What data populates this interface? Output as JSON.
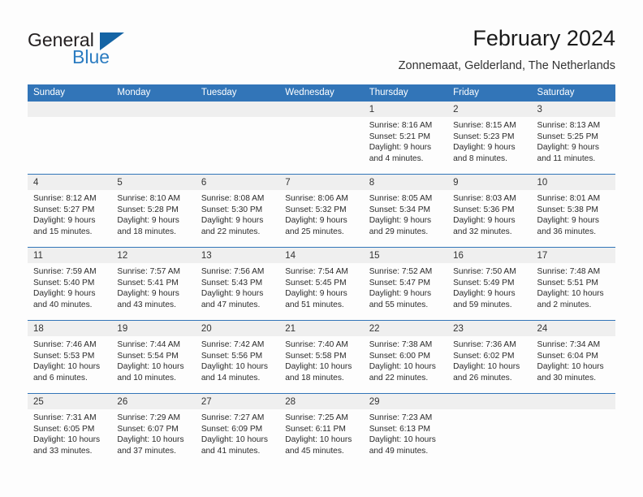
{
  "brand": {
    "name_part1": "General",
    "name_part2": "Blue",
    "triangle_icon": "blue-triangle-logo-icon",
    "accent_color": "#2b7cc1"
  },
  "header": {
    "title": "February 2024",
    "subtitle": "Zonnemaat, Gelderland, The Netherlands"
  },
  "colors": {
    "header_blue": "#3275b8",
    "daynum_band": "#efefef",
    "page_background": "#fdfdfd"
  },
  "calendar": {
    "weekday_headers": [
      "Sunday",
      "Monday",
      "Tuesday",
      "Wednesday",
      "Thursday",
      "Friday",
      "Saturday"
    ],
    "weeks": [
      [
        {
          "day": "",
          "lines": []
        },
        {
          "day": "",
          "lines": []
        },
        {
          "day": "",
          "lines": []
        },
        {
          "day": "",
          "lines": []
        },
        {
          "day": "1",
          "lines": [
            "Sunrise: 8:16 AM",
            "Sunset: 5:21 PM",
            "Daylight: 9 hours",
            "and 4 minutes."
          ]
        },
        {
          "day": "2",
          "lines": [
            "Sunrise: 8:15 AM",
            "Sunset: 5:23 PM",
            "Daylight: 9 hours",
            "and 8 minutes."
          ]
        },
        {
          "day": "3",
          "lines": [
            "Sunrise: 8:13 AM",
            "Sunset: 5:25 PM",
            "Daylight: 9 hours",
            "and 11 minutes."
          ]
        }
      ],
      [
        {
          "day": "4",
          "lines": [
            "Sunrise: 8:12 AM",
            "Sunset: 5:27 PM",
            "Daylight: 9 hours",
            "and 15 minutes."
          ]
        },
        {
          "day": "5",
          "lines": [
            "Sunrise: 8:10 AM",
            "Sunset: 5:28 PM",
            "Daylight: 9 hours",
            "and 18 minutes."
          ]
        },
        {
          "day": "6",
          "lines": [
            "Sunrise: 8:08 AM",
            "Sunset: 5:30 PM",
            "Daylight: 9 hours",
            "and 22 minutes."
          ]
        },
        {
          "day": "7",
          "lines": [
            "Sunrise: 8:06 AM",
            "Sunset: 5:32 PM",
            "Daylight: 9 hours",
            "and 25 minutes."
          ]
        },
        {
          "day": "8",
          "lines": [
            "Sunrise: 8:05 AM",
            "Sunset: 5:34 PM",
            "Daylight: 9 hours",
            "and 29 minutes."
          ]
        },
        {
          "day": "9",
          "lines": [
            "Sunrise: 8:03 AM",
            "Sunset: 5:36 PM",
            "Daylight: 9 hours",
            "and 32 minutes."
          ]
        },
        {
          "day": "10",
          "lines": [
            "Sunrise: 8:01 AM",
            "Sunset: 5:38 PM",
            "Daylight: 9 hours",
            "and 36 minutes."
          ]
        }
      ],
      [
        {
          "day": "11",
          "lines": [
            "Sunrise: 7:59 AM",
            "Sunset: 5:40 PM",
            "Daylight: 9 hours",
            "and 40 minutes."
          ]
        },
        {
          "day": "12",
          "lines": [
            "Sunrise: 7:57 AM",
            "Sunset: 5:41 PM",
            "Daylight: 9 hours",
            "and 43 minutes."
          ]
        },
        {
          "day": "13",
          "lines": [
            "Sunrise: 7:56 AM",
            "Sunset: 5:43 PM",
            "Daylight: 9 hours",
            "and 47 minutes."
          ]
        },
        {
          "day": "14",
          "lines": [
            "Sunrise: 7:54 AM",
            "Sunset: 5:45 PM",
            "Daylight: 9 hours",
            "and 51 minutes."
          ]
        },
        {
          "day": "15",
          "lines": [
            "Sunrise: 7:52 AM",
            "Sunset: 5:47 PM",
            "Daylight: 9 hours",
            "and 55 minutes."
          ]
        },
        {
          "day": "16",
          "lines": [
            "Sunrise: 7:50 AM",
            "Sunset: 5:49 PM",
            "Daylight: 9 hours",
            "and 59 minutes."
          ]
        },
        {
          "day": "17",
          "lines": [
            "Sunrise: 7:48 AM",
            "Sunset: 5:51 PM",
            "Daylight: 10 hours",
            "and 2 minutes."
          ]
        }
      ],
      [
        {
          "day": "18",
          "lines": [
            "Sunrise: 7:46 AM",
            "Sunset: 5:53 PM",
            "Daylight: 10 hours",
            "and 6 minutes."
          ]
        },
        {
          "day": "19",
          "lines": [
            "Sunrise: 7:44 AM",
            "Sunset: 5:54 PM",
            "Daylight: 10 hours",
            "and 10 minutes."
          ]
        },
        {
          "day": "20",
          "lines": [
            "Sunrise: 7:42 AM",
            "Sunset: 5:56 PM",
            "Daylight: 10 hours",
            "and 14 minutes."
          ]
        },
        {
          "day": "21",
          "lines": [
            "Sunrise: 7:40 AM",
            "Sunset: 5:58 PM",
            "Daylight: 10 hours",
            "and 18 minutes."
          ]
        },
        {
          "day": "22",
          "lines": [
            "Sunrise: 7:38 AM",
            "Sunset: 6:00 PM",
            "Daylight: 10 hours",
            "and 22 minutes."
          ]
        },
        {
          "day": "23",
          "lines": [
            "Sunrise: 7:36 AM",
            "Sunset: 6:02 PM",
            "Daylight: 10 hours",
            "and 26 minutes."
          ]
        },
        {
          "day": "24",
          "lines": [
            "Sunrise: 7:34 AM",
            "Sunset: 6:04 PM",
            "Daylight: 10 hours",
            "and 30 minutes."
          ]
        }
      ],
      [
        {
          "day": "25",
          "lines": [
            "Sunrise: 7:31 AM",
            "Sunset: 6:05 PM",
            "Daylight: 10 hours",
            "and 33 minutes."
          ]
        },
        {
          "day": "26",
          "lines": [
            "Sunrise: 7:29 AM",
            "Sunset: 6:07 PM",
            "Daylight: 10 hours",
            "and 37 minutes."
          ]
        },
        {
          "day": "27",
          "lines": [
            "Sunrise: 7:27 AM",
            "Sunset: 6:09 PM",
            "Daylight: 10 hours",
            "and 41 minutes."
          ]
        },
        {
          "day": "28",
          "lines": [
            "Sunrise: 7:25 AM",
            "Sunset: 6:11 PM",
            "Daylight: 10 hours",
            "and 45 minutes."
          ]
        },
        {
          "day": "29",
          "lines": [
            "Sunrise: 7:23 AM",
            "Sunset: 6:13 PM",
            "Daylight: 10 hours",
            "and 49 minutes."
          ]
        },
        {
          "day": "",
          "lines": []
        },
        {
          "day": "",
          "lines": []
        }
      ]
    ]
  }
}
